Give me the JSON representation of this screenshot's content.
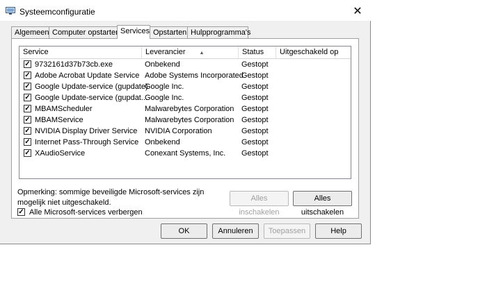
{
  "window": {
    "title": "Systeemconfiguratie",
    "close_glyph": "✕"
  },
  "tabs": [
    {
      "label": "Algemeen",
      "active": false
    },
    {
      "label": "Computer opstarten",
      "active": false
    },
    {
      "label": "Services",
      "active": true
    },
    {
      "label": "Opstarten",
      "active": false
    },
    {
      "label": "Hulpprogramma's",
      "active": false
    }
  ],
  "table": {
    "columns": [
      "Service",
      "Leverancier",
      "Status",
      "Uitgeschakeld op"
    ],
    "sort_glyph": "▲",
    "rows": [
      {
        "checked": true,
        "service": "9732161d37b73cb.exe",
        "vendor": "Onbekend",
        "status": "Gestopt",
        "disabled_on": ""
      },
      {
        "checked": true,
        "service": "Adobe Acrobat Update Service",
        "vendor": "Adobe Systems Incorporated",
        "status": "Gestopt",
        "disabled_on": ""
      },
      {
        "checked": true,
        "service": "Google Update-service (gupdate)",
        "vendor": "Google Inc.",
        "status": "Gestopt",
        "disabled_on": ""
      },
      {
        "checked": true,
        "service": "Google Update-service (gupdat...",
        "vendor": "Google Inc.",
        "status": "Gestopt",
        "disabled_on": ""
      },
      {
        "checked": true,
        "service": "MBAMScheduler",
        "vendor": "Malwarebytes Corporation",
        "status": "Gestopt",
        "disabled_on": ""
      },
      {
        "checked": true,
        "service": "MBAMService",
        "vendor": "Malwarebytes Corporation",
        "status": "Gestopt",
        "disabled_on": ""
      },
      {
        "checked": true,
        "service": "NVIDIA Display Driver Service",
        "vendor": "NVIDIA Corporation",
        "status": "Gestopt",
        "disabled_on": ""
      },
      {
        "checked": true,
        "service": "Internet Pass-Through Service",
        "vendor": "Onbekend",
        "status": "Gestopt",
        "disabled_on": ""
      },
      {
        "checked": true,
        "service": "XAudioService",
        "vendor": "Conexant Systems, Inc.",
        "status": "Gestopt",
        "disabled_on": ""
      }
    ]
  },
  "note": "Opmerking: sommige beveiligde Microsoft-services zijn mogelijk niet uitgeschakeld.",
  "buttons": {
    "enable_all": "Alles inschakelen",
    "disable_all": "Alles uitschakelen",
    "ok": "OK",
    "cancel": "Annuleren",
    "apply": "Toepassen",
    "help": "Help"
  },
  "hide_ms": {
    "label": "Alle Microsoft-services verbergen",
    "checked": true
  },
  "check_glyph": "✓"
}
